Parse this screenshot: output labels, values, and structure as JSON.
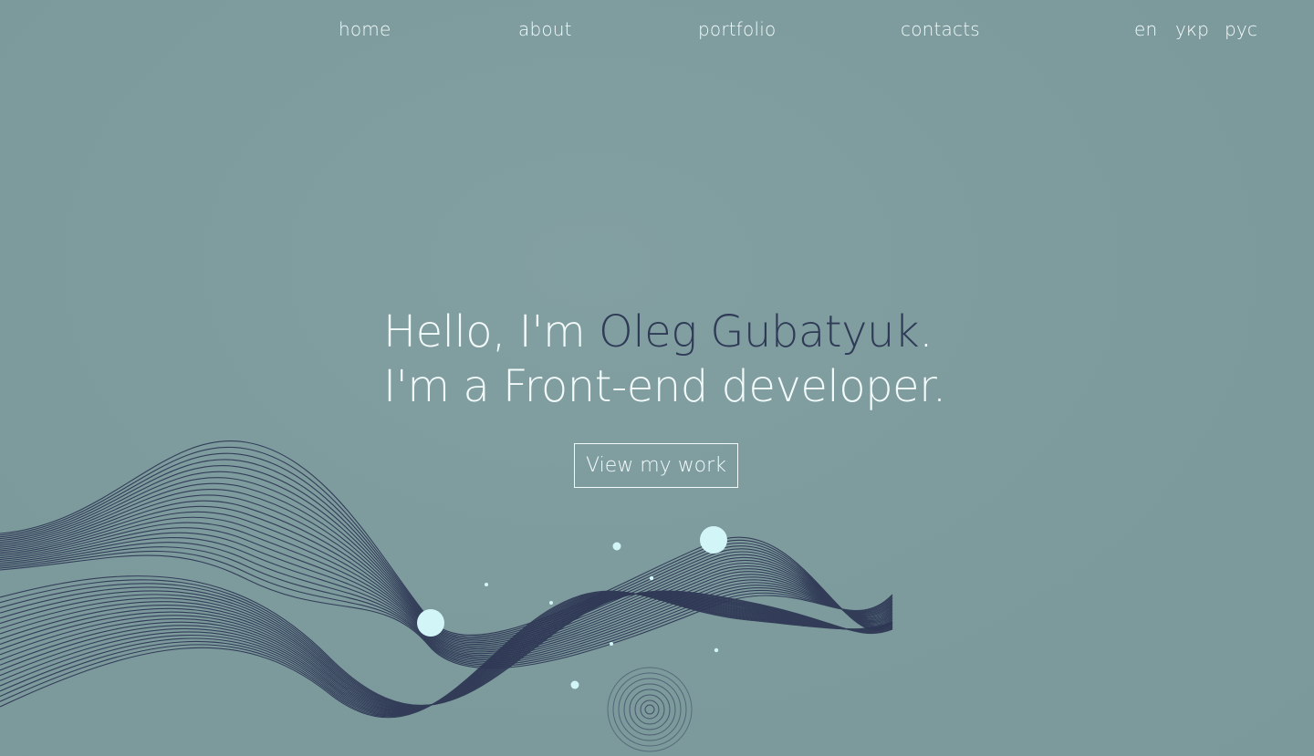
{
  "nav": {
    "items": [
      {
        "label": "home"
      },
      {
        "label": "about"
      },
      {
        "label": "portfolio"
      },
      {
        "label": "contacts"
      }
    ],
    "languages": [
      {
        "label": "en"
      },
      {
        "label": "укр"
      },
      {
        "label": "рус"
      }
    ]
  },
  "hero": {
    "line1_prefix": "Hello, I'm ",
    "name": "Oleg Gubatyuk",
    "line1_suffix": ".",
    "line2": "I'm a Front-end developer."
  },
  "cta": {
    "label": "View my work"
  },
  "colors": {
    "background": "#7e9c9e",
    "text": "#f4fbfb",
    "accent_name": "#2e3a56",
    "wave_lines": "#2f3855",
    "bubbles": "#d2f6f7"
  }
}
